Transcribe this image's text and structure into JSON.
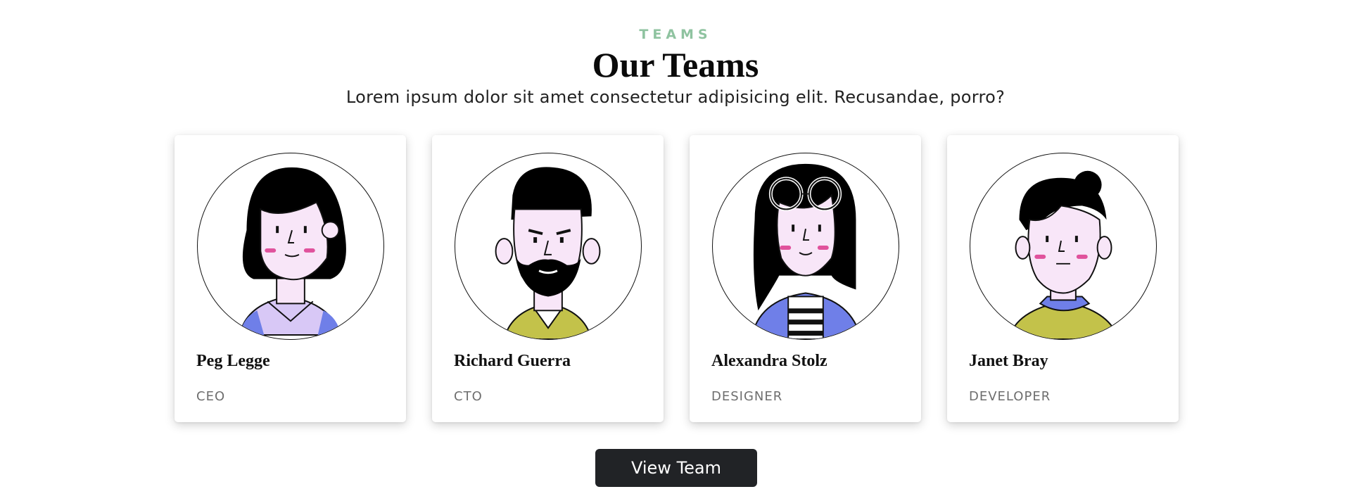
{
  "header": {
    "eyebrow": "TEAMS",
    "title": "Our Teams",
    "subtitle": "Lorem ipsum dolor sit amet consectetur adipisicing elit. Recusandae, porro?"
  },
  "members": [
    {
      "name": "Peg Legge",
      "role": "CEO",
      "avatar_icon": "woman-bob-hair-avatar"
    },
    {
      "name": "Richard Guerra",
      "role": "CTO",
      "avatar_icon": "man-beard-avatar"
    },
    {
      "name": "Alexandra Stolz",
      "role": "DESIGNER",
      "avatar_icon": "woman-glasses-avatar"
    },
    {
      "name": "Janet Bray",
      "role": "DEVELOPER",
      "avatar_icon": "woman-bun-avatar"
    }
  ],
  "cta": {
    "label": "View Team"
  },
  "colors": {
    "eyebrow": "#8fc3a0",
    "button_bg": "#212326",
    "skin": "#f8e6f8",
    "blush": "#e0529c",
    "shirt_blue": "#6f7fe8",
    "shirt_olive": "#c3c24a",
    "shirt_lilac": "#d8c8f6"
  }
}
